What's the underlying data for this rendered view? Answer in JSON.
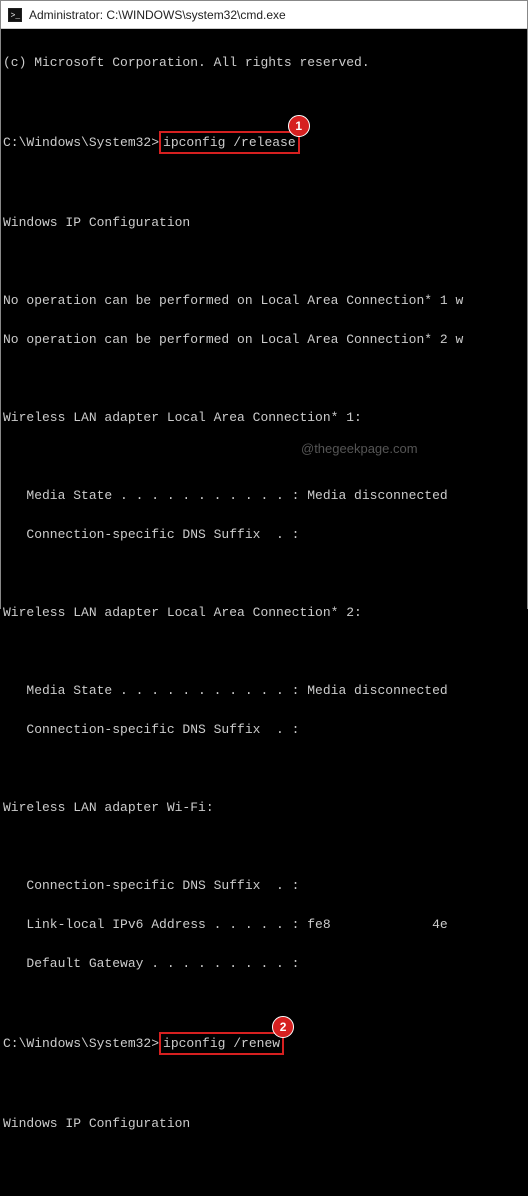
{
  "titlebar": {
    "text": "Administrator: C:\\WINDOWS\\system32\\cmd.exe"
  },
  "terminal": {
    "copyright": "(c) Microsoft Corporation. All rights reserved.",
    "prompt1_path": "C:\\Windows\\System32>",
    "command1": "ipconfig /release",
    "badge1": "1",
    "heading1": "Windows IP Configuration",
    "noop1": "No operation can be performed on Local Area Connection* 1 w",
    "noop2": "No operation can be performed on Local Area Connection* 2 w",
    "adapter1_title": "Wireless LAN adapter Local Area Connection* 1:",
    "adapter1_media": "   Media State . . . . . . . . . . . : Media disconnected",
    "adapter1_dns": "   Connection-specific DNS Suffix  . :",
    "adapter2_title": "Wireless LAN adapter Local Area Connection* 2:",
    "adapter2_media": "   Media State . . . . . . . . . . . : Media disconnected",
    "adapter2_dns": "   Connection-specific DNS Suffix  . :",
    "wifi_title": "Wireless LAN adapter Wi-Fi:",
    "wifi_dns": "   Connection-specific DNS Suffix  . :",
    "wifi_ipv6": "   Link-local IPv6 Address . . . . . : fe8             4e",
    "wifi_gw": "   Default Gateway . . . . . . . . . :",
    "prompt2_path": "C:\\Windows\\System32>",
    "command2": "ipconfig /renew",
    "badge2": "2",
    "heading2": "Windows IP Configuration"
  },
  "watermark": "@thegeekpage.com"
}
